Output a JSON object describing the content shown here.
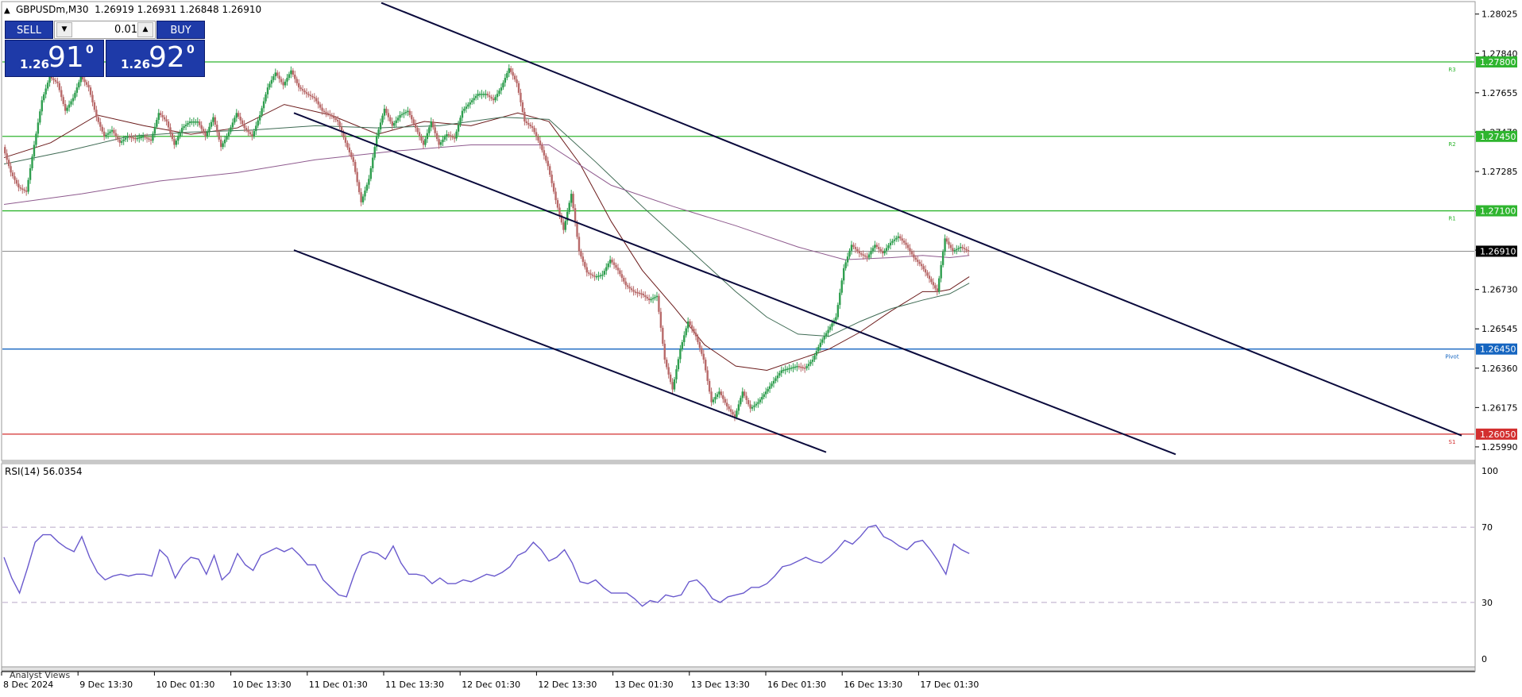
{
  "header": {
    "symbol_info": "GBPUSDm,M30  1.26919 1.26931 1.26848 1.26910"
  },
  "trade_panel": {
    "sell_label": "SELL",
    "buy_label": "BUY",
    "lot": "0.01",
    "sell_prefix": "1.26",
    "sell_big": "91",
    "sell_sup": "0",
    "buy_prefix": "1.26",
    "buy_big": "92",
    "buy_sup": "0"
  },
  "price_axis": {
    "ticks": [
      "1.28025",
      "1.27840",
      "1.27655",
      "1.27470",
      "1.27285",
      "1.27100",
      "1.26915",
      "1.26730",
      "1.26545",
      "1.26360",
      "1.26175",
      "1.25990"
    ],
    "range": [
      1.2593,
      1.2808
    ]
  },
  "levels": [
    {
      "price": 1.278,
      "label": "1.27800",
      "tag": "R3",
      "color": "#2fb52f"
    },
    {
      "price": 1.2745,
      "label": "1.27450",
      "tag": "R2",
      "color": "#2fb52f"
    },
    {
      "price": 1.271,
      "label": "1.27100",
      "tag": "R1",
      "color": "#2fb52f"
    },
    {
      "price": 1.2645,
      "label": "1.26450",
      "tag": "Pivot",
      "color": "#1565c0"
    },
    {
      "price": 1.2605,
      "label": "1.26050",
      "tag": "S1",
      "color": "#d32f2f"
    }
  ],
  "current_price": {
    "price": 1.2691,
    "label": "1.26910"
  },
  "x_axis": {
    "labels": [
      "8 Dec 2024",
      "9 Dec 13:30",
      "10 Dec 01:30",
      "10 Dec 13:30",
      "11 Dec 01:30",
      "11 Dec 13:30",
      "12 Dec 01:30",
      "12 Dec 13:30",
      "13 Dec 01:30",
      "13 Dec 13:30",
      "16 Dec 01:30",
      "16 Dec 13:30",
      "17 Dec 01:30"
    ]
  },
  "rsi": {
    "title": "RSI(14) 56.0354",
    "levels": [
      70,
      30
    ],
    "axis_labels": [
      "100",
      "70",
      "30",
      "0"
    ]
  },
  "status": {
    "bottom_tab": "Analyst Views"
  },
  "chart_data": [
    {
      "type": "line",
      "title": "GBPUSDm,M30  1.26919 1.26931 1.26848 1.26910",
      "series": [
        {
          "kind": "price_close",
          "color": "#b86a6a",
          "upcolor": "#2e9e4e",
          "x": [
            0,
            10,
            20,
            30,
            40,
            50,
            60,
            70,
            80,
            90,
            100,
            110,
            120,
            130,
            140,
            150,
            160,
            170,
            180,
            190,
            200,
            210,
            220,
            230,
            240,
            250,
            260,
            270,
            280,
            290,
            300,
            310,
            320,
            330,
            340,
            350,
            360,
            370,
            380,
            390,
            400,
            410,
            420,
            430,
            440,
            450,
            460,
            470,
            480,
            490,
            500,
            510,
            520,
            530,
            540,
            550,
            560,
            570,
            580,
            590,
            600,
            610,
            620,
            630,
            640,
            650,
            660,
            670,
            680,
            690,
            700,
            710,
            720,
            730,
            740,
            750,
            760,
            770,
            780,
            790,
            800,
            810,
            820,
            830,
            840,
            850,
            860,
            870,
            880,
            890,
            900,
            910,
            920,
            930,
            940,
            950,
            960,
            970,
            980,
            990,
            1000,
            1010,
            1020,
            1030,
            1040,
            1050,
            1060,
            1070,
            1080,
            1090,
            1100,
            1110,
            1120,
            1130,
            1140,
            1150,
            1160,
            1170,
            1180,
            1190,
            1200,
            1210,
            1220,
            1230,
            1240
          ],
          "values": [
            1.274,
            1.2728,
            1.2721,
            1.2719,
            1.2741,
            1.2762,
            1.2773,
            1.277,
            1.2757,
            1.2763,
            1.2773,
            1.2768,
            1.2754,
            1.2745,
            1.2748,
            1.2742,
            1.2745,
            1.2744,
            1.2745,
            1.2743,
            1.2756,
            1.2752,
            1.2741,
            1.2749,
            1.2752,
            1.2752,
            1.2745,
            1.2754,
            1.274,
            1.2747,
            1.2756,
            1.2749,
            1.2745,
            1.2755,
            1.2768,
            1.2775,
            1.2769,
            1.2776,
            1.2768,
            1.2765,
            1.2763,
            1.2757,
            1.2755,
            1.2752,
            1.2742,
            1.2733,
            1.2714,
            1.2725,
            1.2745,
            1.2758,
            1.275,
            1.2755,
            1.2757,
            1.2749,
            1.2741,
            1.2752,
            1.2741,
            1.2746,
            1.2744,
            1.2757,
            1.2761,
            1.2765,
            1.2765,
            1.2762,
            1.2768,
            1.2777,
            1.277,
            1.2752,
            1.2749,
            1.2741,
            1.2731,
            1.2715,
            1.2701,
            1.2718,
            1.2691,
            1.2681,
            1.2679,
            1.268,
            1.2687,
            1.2682,
            1.2675,
            1.2672,
            1.2671,
            1.2668,
            1.267,
            1.264,
            1.2626,
            1.2645,
            1.2658,
            1.2651,
            1.264,
            1.262,
            1.2625,
            1.2618,
            1.2613,
            1.2625,
            1.2617,
            1.262,
            1.2625,
            1.263,
            1.2635,
            1.2636,
            1.2637,
            1.2636,
            1.264,
            1.2648,
            1.2654,
            1.266,
            1.2683,
            1.2694,
            1.269,
            1.2688,
            1.2694,
            1.269,
            1.2695,
            1.2698,
            1.2694,
            1.2688,
            1.2684,
            1.2678,
            1.2672,
            1.2697,
            1.2691,
            1.2693,
            1.2691
          ]
        },
        {
          "kind": "ma_dark",
          "color": "#6b1a1a",
          "x": [
            0,
            60,
            120,
            180,
            240,
            300,
            360,
            420,
            480,
            540,
            600,
            660,
            700,
            740,
            780,
            820,
            860,
            900,
            940,
            980,
            1020,
            1060,
            1100,
            1140,
            1180,
            1200,
            1215,
            1240
          ],
          "values": [
            1.2735,
            1.2742,
            1.2755,
            1.275,
            1.2746,
            1.2749,
            1.276,
            1.2755,
            1.2746,
            1.2752,
            1.275,
            1.2756,
            1.2752,
            1.2732,
            1.2705,
            1.2682,
            1.2665,
            1.2647,
            1.2637,
            1.2635,
            1.264,
            1.2645,
            1.2653,
            1.2663,
            1.2672,
            1.2672,
            1.2673,
            1.2679
          ]
        },
        {
          "kind": "ma_green",
          "color": "#3f6b54",
          "x": [
            0,
            80,
            160,
            240,
            320,
            400,
            480,
            560,
            640,
            700,
            760,
            820,
            880,
            940,
            980,
            1020,
            1060,
            1100,
            1140,
            1180,
            1215,
            1240
          ],
          "values": [
            1.2732,
            1.2738,
            1.2745,
            1.2747,
            1.2748,
            1.275,
            1.2749,
            1.275,
            1.2754,
            1.2753,
            1.2733,
            1.2712,
            1.2692,
            1.2672,
            1.266,
            1.2652,
            1.2651,
            1.2658,
            1.2664,
            1.2668,
            1.2671,
            1.2676
          ]
        },
        {
          "kind": "ma_purple",
          "color": "#8e5a8e",
          "x": [
            0,
            100,
            200,
            300,
            400,
            500,
            600,
            700,
            780,
            860,
            940,
            1020,
            1080,
            1140,
            1180,
            1215,
            1240
          ],
          "values": [
            1.2713,
            1.2718,
            1.2724,
            1.2728,
            1.2734,
            1.2738,
            1.2741,
            1.2741,
            1.2722,
            1.2712,
            1.2703,
            1.2693,
            1.2687,
            1.2688,
            1.2689,
            1.2688,
            1.2689
          ]
        }
      ],
      "trendlines": [
        {
          "points": [
            [
              480,
              1.28078
            ],
            [
              1840,
              1.26043
            ]
          ]
        },
        {
          "points": [
            [
              370,
              1.2756
            ],
            [
              1480,
              1.25955
            ]
          ]
        },
        {
          "points": [
            [
              370,
              1.26915
            ],
            [
              1040,
              1.25965
            ]
          ]
        }
      ]
    },
    {
      "type": "line",
      "title": "RSI(14) 56.0354",
      "ylim": [
        0,
        100
      ],
      "series": [
        {
          "color": "#6a5acd",
          "x": [
            0,
            10,
            20,
            30,
            40,
            50,
            60,
            70,
            80,
            90,
            100,
            110,
            120,
            130,
            140,
            150,
            160,
            170,
            180,
            190,
            200,
            210,
            220,
            230,
            240,
            250,
            260,
            270,
            280,
            290,
            300,
            310,
            320,
            330,
            340,
            350,
            360,
            370,
            380,
            390,
            400,
            410,
            420,
            430,
            440,
            450,
            460,
            470,
            480,
            490,
            500,
            510,
            520,
            530,
            540,
            550,
            560,
            570,
            580,
            590,
            600,
            610,
            620,
            630,
            640,
            650,
            660,
            670,
            680,
            690,
            700,
            710,
            720,
            730,
            740,
            750,
            760,
            770,
            780,
            790,
            800,
            810,
            820,
            830,
            840,
            850,
            860,
            870,
            880,
            890,
            900,
            910,
            920,
            930,
            940,
            950,
            960,
            970,
            980,
            990,
            1000,
            1010,
            1020,
            1030,
            1040,
            1050,
            1060,
            1070,
            1080,
            1090,
            1100,
            1110,
            1120,
            1130,
            1140,
            1150,
            1160,
            1170,
            1180,
            1190,
            1200,
            1210,
            1220,
            1230,
            1240
          ],
          "values": [
            54,
            43,
            35,
            48,
            62,
            66,
            66,
            62,
            59,
            57,
            65,
            54,
            46,
            42,
            44,
            45,
            44,
            45,
            45,
            44,
            58,
            54,
            43,
            50,
            54,
            53,
            45,
            55,
            42,
            46,
            56,
            50,
            47,
            55,
            57,
            59,
            57,
            59,
            55,
            50,
            50,
            42,
            38,
            34,
            33,
            45,
            55,
            57,
            56,
            53,
            60,
            51,
            45,
            45,
            44,
            40,
            43,
            40,
            40,
            42,
            41,
            43,
            45,
            44,
            46,
            49,
            55,
            57,
            62,
            58,
            52,
            54,
            58,
            51,
            41,
            40,
            42,
            38,
            35,
            35,
            35,
            32,
            28,
            31,
            30,
            34,
            33,
            34,
            41,
            42,
            38,
            32,
            30,
            33,
            34,
            35,
            38,
            38,
            40,
            44,
            49,
            50,
            52,
            54,
            52,
            51,
            54,
            58,
            63,
            61,
            65,
            70,
            71,
            65,
            63,
            60,
            58,
            62,
            63,
            58,
            52,
            45,
            61,
            58,
            56
          ]
        }
      ]
    }
  ]
}
